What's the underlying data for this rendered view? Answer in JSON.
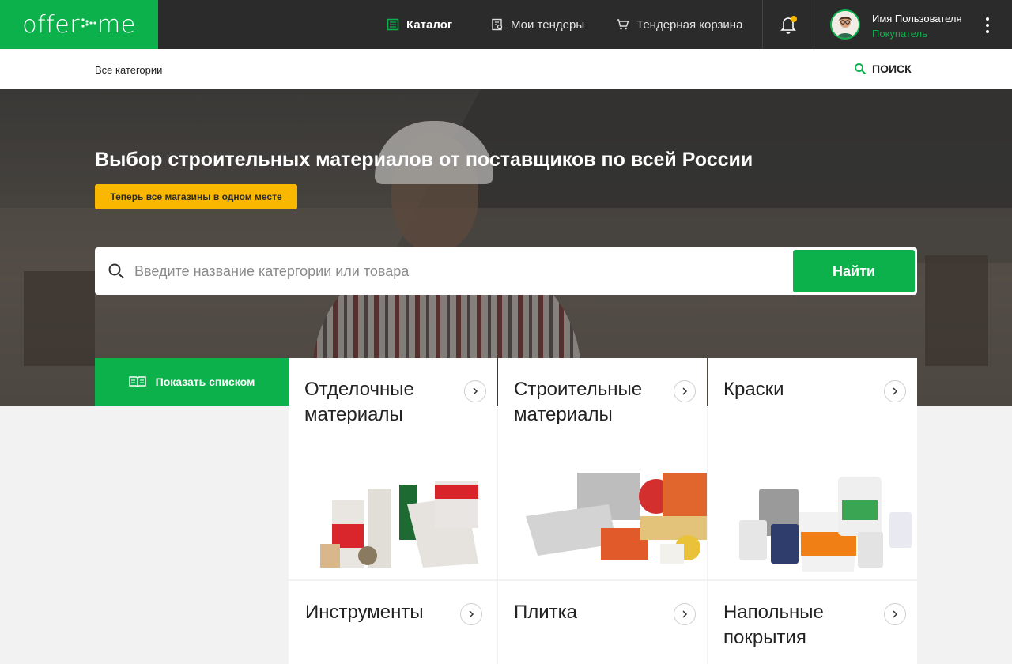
{
  "header": {
    "logo": {
      "left": "offer",
      "right": "me"
    },
    "nav": [
      {
        "label": "Каталог",
        "icon": "catalog-icon"
      },
      {
        "label": "Мои тендеры",
        "icon": "tenders-icon"
      },
      {
        "label": "Тендерная корзина",
        "icon": "cart-icon"
      }
    ],
    "user": {
      "name": "Имя Пользователя",
      "role": "Покупатель"
    }
  },
  "subbar": {
    "breadcrumb": "Все категории",
    "search_label": "ПОИСК"
  },
  "hero": {
    "title": "Выбор строительных материалов от поставщиков по всей России",
    "badge": "Теперь все магазины в одном месте",
    "search_placeholder": "Введите название катергории или товара",
    "search_button": "Найти"
  },
  "list_button": "Показать списком",
  "categories": [
    {
      "title": "Отделочные материалы"
    },
    {
      "title": "Строительные материалы"
    },
    {
      "title": "Краски"
    },
    {
      "title": "Инструменты"
    },
    {
      "title": "Плитка"
    },
    {
      "title": "Напольные покрытия"
    }
  ],
  "colors": {
    "brand_green": "#0db14b",
    "header_bg": "#2b2b2b",
    "badge_yellow": "#f9b700"
  }
}
